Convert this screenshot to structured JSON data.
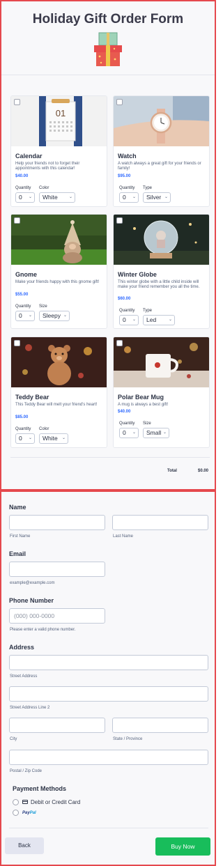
{
  "form": {
    "title": "Holiday Gift Order Form"
  },
  "products": [
    {
      "name": "Calendar",
      "description": "Help your friends not to forget their appointments with this calendar!",
      "price": "$40.00",
      "option1_label": "Quantity",
      "option1_value": "0",
      "option2_label": "Color",
      "option2_value": "White",
      "image_text": "01"
    },
    {
      "name": "Watch",
      "description": "A watch always a great gift for your friends or family!",
      "price": "$95.00",
      "option1_label": "Quantity",
      "option1_value": "0",
      "option2_label": "Type",
      "option2_value": "Silver"
    },
    {
      "name": "Gnome",
      "description": "Make your friends happy with this gnome gift!",
      "price": "$55.00",
      "option1_label": "Quantity",
      "option1_value": "0",
      "option2_label": "Size",
      "option2_value": "Sleepy"
    },
    {
      "name": "Winter Globe",
      "description": "This winter globe with a little child inside will make your friend remember you all the time.",
      "price": "$60.00",
      "option1_label": "Quantity",
      "option1_value": "0",
      "option2_label": "Type",
      "option2_value": "Led"
    },
    {
      "name": "Teddy Bear",
      "description": "This Teddy Bear will melt your friend's heart!",
      "price": "$85.00",
      "option1_label": "Quantity",
      "option1_value": "0",
      "option2_label": "Color",
      "option2_value": "White"
    },
    {
      "name": "Polar Bear Mug",
      "description": "A mug is always a best gift!",
      "price": "$40.00",
      "option1_label": "Quantity",
      "option1_value": "0",
      "option2_label": "Size",
      "option2_value": "Small"
    }
  ],
  "total": {
    "label": "Total",
    "value": "$0.00"
  },
  "name": {
    "label": "Name",
    "first_sub": "First Name",
    "last_sub": "Last Name"
  },
  "email": {
    "label": "Email",
    "sub": "example@example.com"
  },
  "phone": {
    "label": "Phone Number",
    "placeholder": "(000) 000-0000",
    "sub": "Please enter a valid phone number."
  },
  "address": {
    "label": "Address",
    "street_sub": "Street Address",
    "street2_sub": "Street Address Line 2",
    "city_sub": "City",
    "state_sub": "State / Province",
    "zip_sub": "Postal / Zip Code"
  },
  "payment": {
    "title": "Payment Methods",
    "card_label": "Debit or Credit Card",
    "paypal_a": "Pay",
    "paypal_b": "Pal",
    "card_icon": "credit-card-icon"
  },
  "buttons": {
    "back": "Back",
    "buy": "Buy Now"
  },
  "colors": {
    "frame": "#e5484d",
    "accent_price": "#2e69ff",
    "buy_button": "#18bd5b"
  }
}
